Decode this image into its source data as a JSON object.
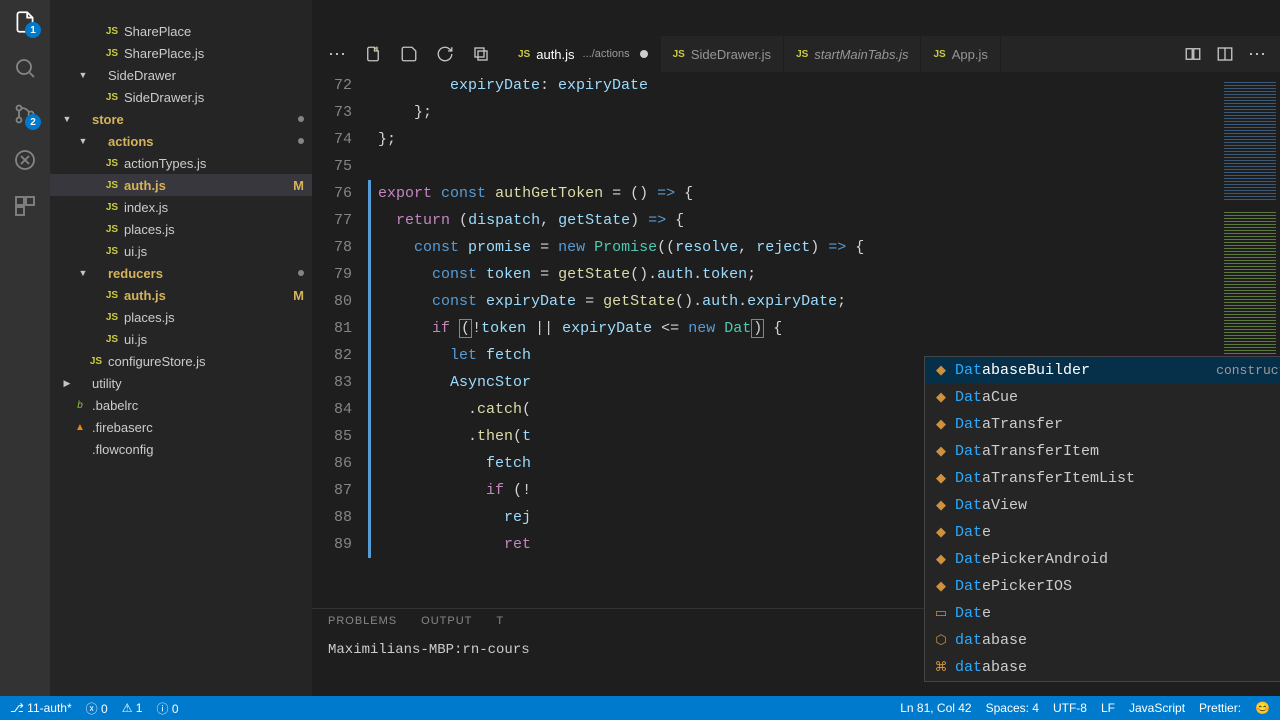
{
  "toolbar": {
    "overflow": "⋯"
  },
  "activity": {
    "explorer_badge": "1",
    "scm_badge": "2"
  },
  "sidebar": {
    "items": [
      {
        "type": "file",
        "depth": 2,
        "icon": "js",
        "label": "SharePlace",
        "dim": true
      },
      {
        "type": "file",
        "depth": 2,
        "icon": "js",
        "label": "SharePlace.js"
      },
      {
        "type": "folder",
        "depth": 1,
        "open": true,
        "label": "SideDrawer"
      },
      {
        "type": "file",
        "depth": 2,
        "icon": "js",
        "label": "SideDrawer.js"
      },
      {
        "type": "folder",
        "depth": 0,
        "open": true,
        "label": "store",
        "mod": true,
        "dotmuted": true
      },
      {
        "type": "folder",
        "depth": 1,
        "open": true,
        "label": "actions",
        "mod": true,
        "dotmuted": true
      },
      {
        "type": "file",
        "depth": 2,
        "icon": "js",
        "label": "actionTypes.js"
      },
      {
        "type": "file",
        "depth": 2,
        "icon": "js",
        "label": "auth.js",
        "selected": true,
        "mod": true,
        "status": "M"
      },
      {
        "type": "file",
        "depth": 2,
        "icon": "js",
        "label": "index.js"
      },
      {
        "type": "file",
        "depth": 2,
        "icon": "js",
        "label": "places.js"
      },
      {
        "type": "file",
        "depth": 2,
        "icon": "js",
        "label": "ui.js"
      },
      {
        "type": "folder",
        "depth": 1,
        "open": true,
        "label": "reducers",
        "mod": true,
        "dotmuted": true
      },
      {
        "type": "file",
        "depth": 2,
        "icon": "js",
        "label": "auth.js",
        "mod": true,
        "status": "M"
      },
      {
        "type": "file",
        "depth": 2,
        "icon": "js",
        "label": "places.js"
      },
      {
        "type": "file",
        "depth": 2,
        "icon": "js",
        "label": "ui.js"
      },
      {
        "type": "file",
        "depth": 1,
        "icon": "js",
        "label": "configureStore.js"
      },
      {
        "type": "folder",
        "depth": 0,
        "open": false,
        "label": "utility"
      },
      {
        "type": "file",
        "depth": 0,
        "icon": "babel",
        "label": ".babelrc"
      },
      {
        "type": "file",
        "depth": 0,
        "icon": "fire",
        "label": ".firebaserc"
      },
      {
        "type": "file",
        "depth": 0,
        "icon": "flow",
        "label": ".flowconfig"
      }
    ]
  },
  "tabs": [
    {
      "icon": "js",
      "label": "auth.js",
      "sub": ".../actions",
      "active": true,
      "dirty": true
    },
    {
      "icon": "js",
      "label": "SideDrawer.js"
    },
    {
      "icon": "js",
      "label": "startMainTabs.js",
      "italic": true
    },
    {
      "icon": "js",
      "label": "App.js"
    }
  ],
  "gutter_start": 72,
  "code_lines": [
    "        <span class='tok-v'>expiryDate</span><span class='tok-c'>: </span><span class='tok-v'>expiryDate</span>",
    "    <span class='tok-c'>};</span>",
    "<span class='tok-c'>};</span>",
    "",
    "<span class='tok-k'>export</span> <span class='tok-kw'>const</span> <span class='tok-fn'>authGetToken</span> <span class='tok-c'>= () </span><span class='tok-kw'>=></span><span class='tok-c'> {</span>",
    "  <span class='tok-k'>return</span> <span class='tok-c'>(</span><span class='tok-v'>dispatch</span><span class='tok-c'>, </span><span class='tok-v'>getState</span><span class='tok-c'>) </span><span class='tok-kw'>=></span><span class='tok-c'> {</span>",
    "    <span class='tok-kw'>const</span> <span class='tok-v'>promise</span> <span class='tok-c'>= </span><span class='tok-kw'>new</span> <span class='tok-t'>Promise</span><span class='tok-c'>((</span><span class='tok-v'>resolve</span><span class='tok-c'>, </span><span class='tok-v'>reject</span><span class='tok-c'>) </span><span class='tok-kw'>=></span><span class='tok-c'> {</span>",
    "      <span class='tok-kw'>const</span> <span class='tok-v'>token</span> <span class='tok-c'>= </span><span class='tok-fn'>getState</span><span class='tok-c'>().</span><span class='tok-v'>auth</span><span class='tok-c'>.</span><span class='tok-v'>token</span><span class='tok-c'>;</span>",
    "      <span class='tok-kw'>const</span> <span class='tok-v'>expiryDate</span> <span class='tok-c'>= </span><span class='tok-fn'>getState</span><span class='tok-c'>().</span><span class='tok-v'>auth</span><span class='tok-c'>.</span><span class='tok-v'>expiryDate</span><span class='tok-c'>;</span>",
    "      <span class='tok-k'>if</span> <span class='tok-c bracket'>(</span><span class='tok-c'>!</span><span class='tok-v'>token</span> <span class='tok-c'>||</span> <span class='tok-v'>expiryDate</span> <span class='tok-c'>&lt;=</span> <span class='tok-kw'>new</span> <span class='tok-t'>Dat</span><span class='tok-c bracket'>)</span><span class='tok-c'> {</span>",
    "        <span class='tok-kw'>let</span> <span class='tok-v'>fetch</span>",
    "        <span class='tok-v'>AsyncStor</span>",
    "          <span class='tok-c'>.</span><span class='tok-fn'>catch</span><span class='tok-c'>(</span>",
    "          <span class='tok-c'>.</span><span class='tok-fn'>then</span><span class='tok-c'>(</span><span class='tok-v'>t</span>",
    "            <span class='tok-v'>fetch</span>",
    "            <span class='tok-k'>if</span> <span class='tok-c'>(!</span>",
    "              <span class='tok-v'>rej</span>",
    "              <span class='tok-k'>ret</span>"
  ],
  "suggest": {
    "items": [
      {
        "match": "Dat",
        "rest": "abaseBuilder",
        "detail": "constructor DatabaseBuilder(): Data…",
        "sel": true,
        "icon": "class"
      },
      {
        "match": "Dat",
        "rest": "aCue",
        "icon": "class"
      },
      {
        "match": "Dat",
        "rest": "aTransfer",
        "icon": "class"
      },
      {
        "match": "Dat",
        "rest": "aTransferItem",
        "icon": "class"
      },
      {
        "match": "Dat",
        "rest": "aTransferItemList",
        "icon": "class"
      },
      {
        "match": "Dat",
        "rest": "aView",
        "icon": "class"
      },
      {
        "match": "Dat",
        "rest": "e",
        "icon": "class"
      },
      {
        "match": "Dat",
        "rest": "ePickerAndroid",
        "icon": "class"
      },
      {
        "match": "Dat",
        "rest": "ePickerIOS",
        "icon": "class"
      },
      {
        "match": "Dat",
        "rest": "e",
        "icon": "text"
      },
      {
        "match": "dat",
        "rest": "abase",
        "icon": "var"
      },
      {
        "match": "dat",
        "rest": "abase",
        "icon": "snippet"
      }
    ]
  },
  "panel": {
    "tabs": [
      "PROBLEMS",
      "OUTPUT",
      "T"
    ],
    "terminal": "Maximilians-MBP:rn-cours"
  },
  "status": {
    "branch": "11-auth*",
    "errors": "0",
    "warnings": "1",
    "info": "0",
    "pos": "Ln 81, Col 42",
    "spaces": "Spaces: 4",
    "enc": "UTF-8",
    "eol": "LF",
    "lang": "JavaScript",
    "prettier": "Prettier: ",
    "smile": "😊"
  }
}
